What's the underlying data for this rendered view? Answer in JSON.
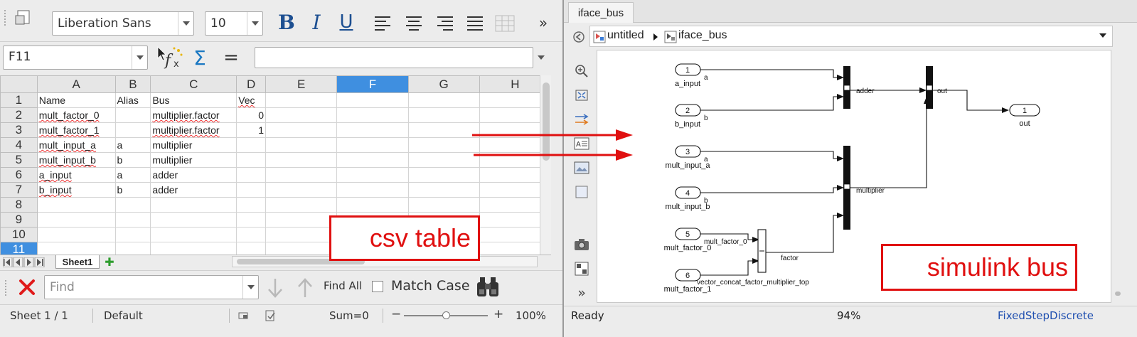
{
  "calc": {
    "toolbar": {
      "font_name": "Liberation Sans",
      "font_size": "10",
      "bold": "B",
      "italic": "I",
      "underline": "U",
      "overflow": "»"
    },
    "formula": {
      "cell_ref": "F11",
      "sum_icon": "Σ",
      "equals": "=",
      "value": ""
    },
    "columns": [
      "A",
      "B",
      "C",
      "D",
      "E",
      "F",
      "G",
      "H"
    ],
    "selected_column": "F",
    "rows": [
      {
        "n": "1",
        "cells": [
          "Name",
          "Alias",
          "Bus",
          "Vec",
          "",
          "",
          "",
          ""
        ]
      },
      {
        "n": "2",
        "cells": [
          "mult_factor_0",
          "",
          "multiplier.factor",
          "0",
          "",
          "",
          "",
          ""
        ]
      },
      {
        "n": "3",
        "cells": [
          "mult_factor_1",
          "",
          "multiplier.factor",
          "1",
          "",
          "",
          "",
          ""
        ]
      },
      {
        "n": "4",
        "cells": [
          "mult_input_a",
          "a",
          "multiplier",
          "",
          "",
          "",
          "",
          ""
        ]
      },
      {
        "n": "5",
        "cells": [
          "mult_input_b",
          "b",
          "multiplier",
          "",
          "",
          "",
          "",
          ""
        ]
      },
      {
        "n": "6",
        "cells": [
          "a_input",
          "a",
          "adder",
          "",
          "",
          "",
          "",
          ""
        ]
      },
      {
        "n": "7",
        "cells": [
          "b_input",
          "b",
          "adder",
          "",
          "",
          "",
          "",
          ""
        ]
      },
      {
        "n": "8",
        "cells": [
          "",
          "",
          "",
          "",
          "",
          "",
          "",
          ""
        ]
      },
      {
        "n": "9",
        "cells": [
          "",
          "",
          "",
          "",
          "",
          "",
          "",
          ""
        ]
      },
      {
        "n": "10",
        "cells": [
          "",
          "",
          "",
          "",
          "",
          "",
          "",
          ""
        ]
      },
      {
        "n": "11",
        "cells": [
          "",
          "",
          "",
          "",
          "",
          "",
          "",
          ""
        ]
      }
    ],
    "sheet_tab": "Sheet1",
    "find": {
      "placeholder": "Find",
      "find_all": "Find All",
      "match_case": "Match Case"
    },
    "status": {
      "sheet": "Sheet 1 / 1",
      "style": "Default",
      "sum": "Sum=0",
      "zoom": "100%"
    },
    "annotation": "csv table"
  },
  "simulink": {
    "tab": "iface_bus",
    "breadcrumb": [
      "untitled",
      "iface_bus"
    ],
    "status": {
      "ready": "Ready",
      "zoom": "94%",
      "solver": "FixedStepDiscrete"
    },
    "annotation": "simulink bus",
    "model": {
      "inports": [
        {
          "num": "1",
          "name": "a_input",
          "sig": "a"
        },
        {
          "num": "2",
          "name": "b_input",
          "sig": "b"
        },
        {
          "num": "3",
          "name": "mult_input_a",
          "sig": "a"
        },
        {
          "num": "4",
          "name": "mult_input_b",
          "sig": "b"
        },
        {
          "num": "5",
          "name": "mult_factor_0",
          "sig": "mult_factor_0"
        },
        {
          "num": "6",
          "name": "mult_factor_1",
          "sig": "vector_concat_factor_multiplier_top"
        }
      ],
      "buses": {
        "adder": "adder",
        "multiplier": "multiplier",
        "factor": "factor",
        "out": "out"
      },
      "outport": {
        "num": "1",
        "name": "out"
      }
    }
  }
}
